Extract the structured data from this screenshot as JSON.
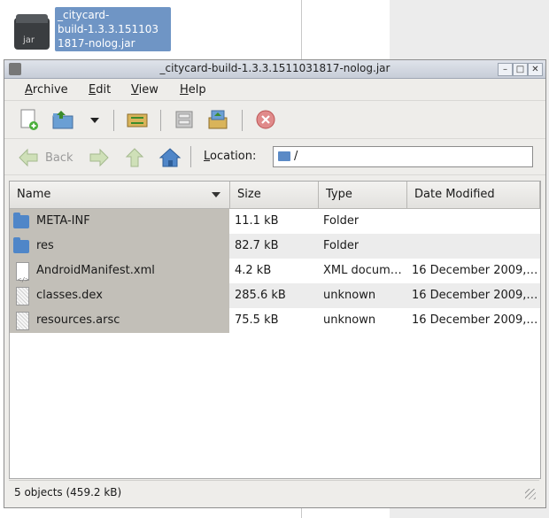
{
  "desktop": {
    "icon_tag": "jar",
    "label_lines": [
      "_citycard-",
      "build-1.3.3.151103",
      "1817-nolog.jar"
    ]
  },
  "window": {
    "title": "_citycard-build-1.3.3.1511031817-nolog.jar",
    "controls": [
      "minimize",
      "maximize",
      "close"
    ]
  },
  "menu": {
    "archive": {
      "first": "A",
      "rest": "rchive"
    },
    "edit": {
      "first": "E",
      "rest": "dit"
    },
    "view": {
      "first": "V",
      "rest": "iew"
    },
    "help": {
      "first": "H",
      "rest": "elp"
    }
  },
  "toolbar": {
    "icons": [
      "new-archive-icon",
      "open-archive-icon",
      "dropdown-arrow-icon",
      "reload-icon",
      "extract-icon",
      "add-files-icon",
      "stop-icon"
    ]
  },
  "navigation": {
    "back_label": "Back",
    "location_label_first": "L",
    "location_label_rest": "ocation:",
    "location_value": "/"
  },
  "file_list": {
    "columns": [
      "Name",
      "Size",
      "Type",
      "Date Modified"
    ],
    "rows": [
      {
        "name": "META-INF",
        "size": "11.1 kB",
        "type": "Folder",
        "date": "",
        "icon": "folder"
      },
      {
        "name": "res",
        "size": "82.7 kB",
        "type": "Folder",
        "date": "",
        "icon": "folder"
      },
      {
        "name": "AndroidManifest.xml",
        "size": "4.2 kB",
        "type": "XML docum…",
        "date": "16 December 2009,…",
        "icon": "xml-file"
      },
      {
        "name": "classes.dex",
        "size": "285.6 kB",
        "type": "unknown",
        "date": "16 December 2009,…",
        "icon": "file"
      },
      {
        "name": "resources.arsc",
        "size": "75.5 kB",
        "type": "unknown",
        "date": "16 December 2009,…",
        "icon": "file"
      }
    ]
  },
  "status": {
    "text": "5 objects (459.2 kB)"
  },
  "colors": {
    "selection": "#6f95c5",
    "folder": "#4f86c8",
    "name_column": "#c2bfb8"
  }
}
